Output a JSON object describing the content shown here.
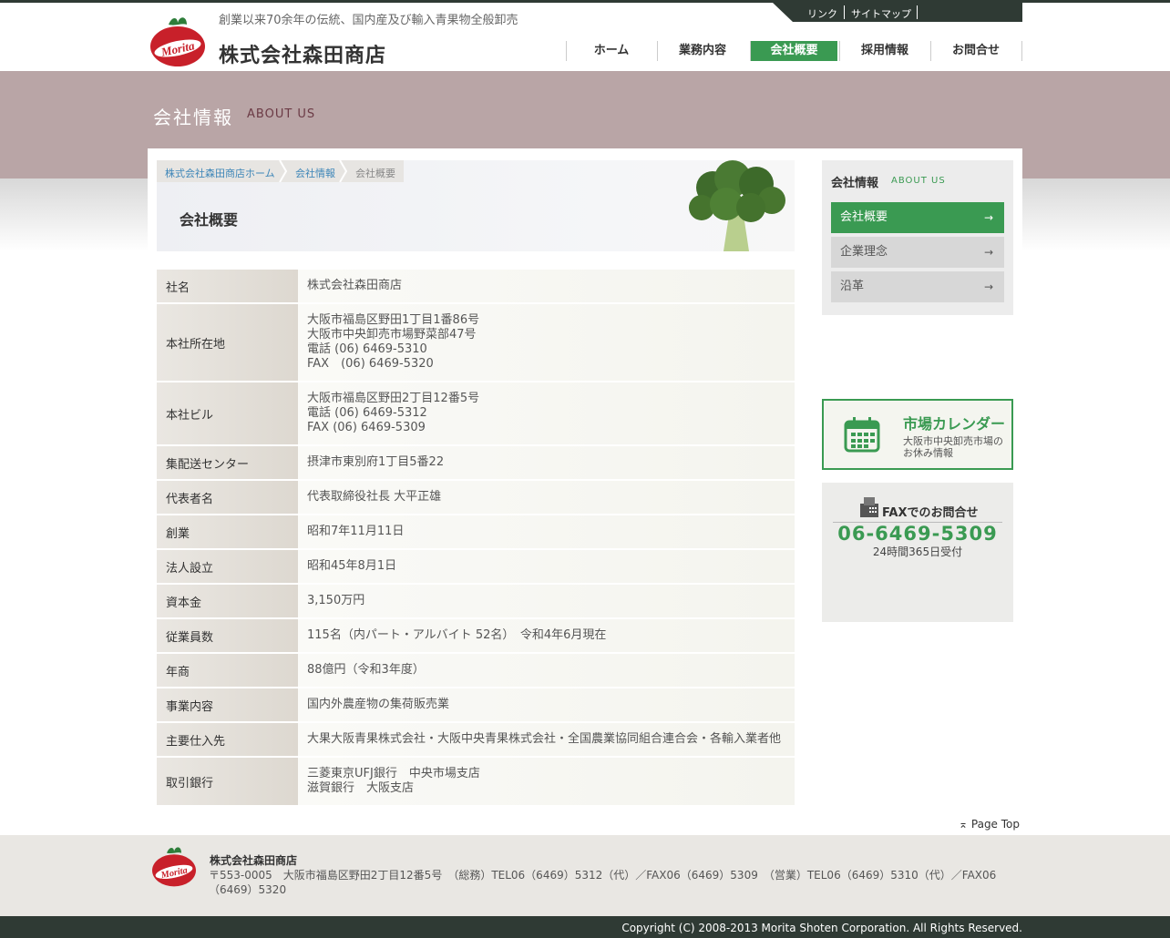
{
  "header": {
    "tagline": "創業以来70余年の伝統、国内産及び輸入青果物全般卸売",
    "company_name": "株式会社森田商店",
    "util_links": [
      "リンク",
      "サイトマップ"
    ],
    "nav": [
      {
        "label": "ホーム",
        "active": false
      },
      {
        "label": "業務内容",
        "active": false
      },
      {
        "label": "会社概要",
        "active": true
      },
      {
        "label": "採用情報",
        "active": false
      },
      {
        "label": "お問合せ",
        "active": false
      }
    ]
  },
  "banner": {
    "title_jp": "会社情報",
    "title_en": "ABOUT US"
  },
  "breadcrumb": [
    "株式会社森田商店ホーム",
    "会社情報",
    "会社概要"
  ],
  "page_title": "会社概要",
  "table": [
    {
      "label": "社名",
      "lines": [
        "株式会社森田商店"
      ]
    },
    {
      "label": "本社所在地",
      "lines": [
        "大阪市福島区野田1丁目1番86号",
        "大阪市中央卸売市場野菜部47号",
        "電話 (06) 6469-5310",
        "FAX　(06) 6469-5320"
      ]
    },
    {
      "label": "本社ビル",
      "lines": [
        "大阪市福島区野田2丁目12番5号",
        "電話 (06) 6469-5312",
        "FAX (06) 6469-5309"
      ]
    },
    {
      "label": "集配送センター",
      "lines": [
        "摂津市東別府1丁目5番22"
      ]
    },
    {
      "label": "代表者名",
      "lines": [
        "代表取締役社長 大平正雄"
      ]
    },
    {
      "label": "創業",
      "lines": [
        "昭和7年11月11日"
      ]
    },
    {
      "label": "法人設立",
      "lines": [
        "昭和45年8月1日"
      ]
    },
    {
      "label": "資本金",
      "lines": [
        "3,150万円"
      ]
    },
    {
      "label": "従業員数",
      "lines": [
        "115名（内パート・アルバイト 52名）　令和4年6月現在"
      ]
    },
    {
      "label": "年商",
      "lines": [
        "88億円（令和3年度）"
      ]
    },
    {
      "label": "事業内容",
      "lines": [
        "国内外農産物の集荷販売業"
      ]
    },
    {
      "label": "主要仕入先",
      "lines": [
        "大果大阪青果株式会社・大阪中央青果株式会社・全国農業協同組合連合会・各輸入業者他"
      ]
    },
    {
      "label": "取引銀行",
      "lines": [
        "三菱東京UFJ銀行　中央市場支店",
        "滋賀銀行　大阪支店"
      ]
    }
  ],
  "sidebar": {
    "title_jp": "会社情報",
    "title_en": "ABOUT US",
    "items": [
      {
        "label": "会社概要",
        "active": true
      },
      {
        "label": "企業理念",
        "active": false
      },
      {
        "label": "沿革",
        "active": false
      }
    ],
    "arrow": "→",
    "calendar": {
      "title": "市場カレンダー",
      "sub": "大阪市中央卸売市場のお休み情報"
    },
    "fax": {
      "label": "FAXでのお問合せ",
      "number": "06-6469-5309",
      "hours": "24時間365日受付"
    }
  },
  "pagetop": "Page Top",
  "footer": {
    "name": "株式会社森田商店",
    "address": "〒553-0005　大阪市福島区野田2丁目12番5号　（総務）TEL06（6469）5312（代）／FAX06（6469）5309　（営業）TEL06（6469）5310（代）／FAX06（6469）5320",
    "copyright": "Copyright (C) 2008-2013 Morita Shoten Corporation. All Rights Reserved."
  },
  "logo_text": "Morita",
  "colors": {
    "accent_green": "#3a9a52",
    "dark_bar": "#2f3a34",
    "banner_mauve": "#b9a5a6"
  }
}
